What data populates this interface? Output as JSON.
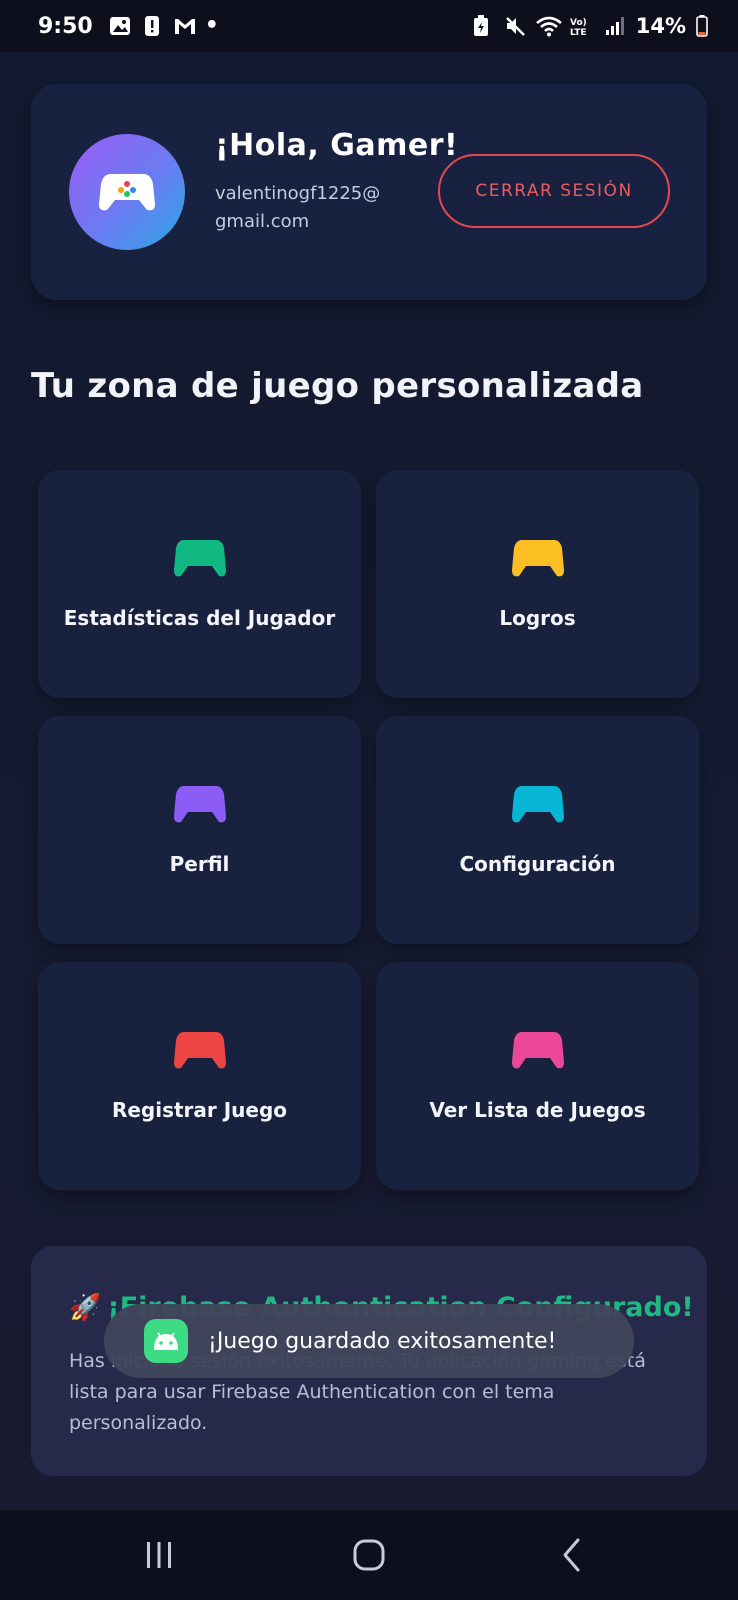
{
  "status_bar": {
    "time": "9:50",
    "dot": "•",
    "battery": "14%",
    "left_icons": [
      "gallery-icon",
      "alert-icon",
      "gmail-icon"
    ],
    "right_icons": [
      "battery-saver-icon",
      "mute-icon",
      "wifi-icon",
      "volte-icon",
      "signal-icon",
      "battery-icon"
    ]
  },
  "header": {
    "greeting": "¡Hola, Gamer!",
    "email": "valentinogf1225@gmail.com",
    "logout_label": "CERRAR SESIÓN",
    "avatar_icon": "gamepad-icon"
  },
  "section_title": "Tu zona de juego personalizada",
  "tiles": [
    {
      "label": "Estadísticas del Jugador",
      "icon": "gamepad-icon",
      "color": "#10b981"
    },
    {
      "label": "Logros",
      "icon": "gamepad-icon",
      "color": "#fbbf24"
    },
    {
      "label": "Perfil",
      "icon": "gamepad-icon",
      "color": "#8b5cf6"
    },
    {
      "label": "Configuración",
      "icon": "gamepad-icon",
      "color": "#06b6d4"
    },
    {
      "label": "Registrar Juego",
      "icon": "gamepad-icon",
      "color": "#ef4444"
    },
    {
      "label": "Ver Lista de Juegos",
      "icon": "gamepad-icon",
      "color": "#ec4899"
    }
  ],
  "info_card": {
    "icon": "🚀",
    "title": "¡Firebase Authentication Configurado!",
    "text": "Has iniciado sesión exitosamente. Tu aplicación gaming está lista para usar Firebase Authentication con el tema personalizado."
  },
  "toast": {
    "text": "¡Juego guardado exitosamente!",
    "icon": "android-icon"
  },
  "colors": {
    "background": "#141a2e",
    "card": "#182240",
    "accent_red": "#e5484f",
    "info_green": "#1fb882"
  },
  "nav_bar": {
    "buttons": [
      "recents-button",
      "home-button",
      "back-button"
    ]
  }
}
